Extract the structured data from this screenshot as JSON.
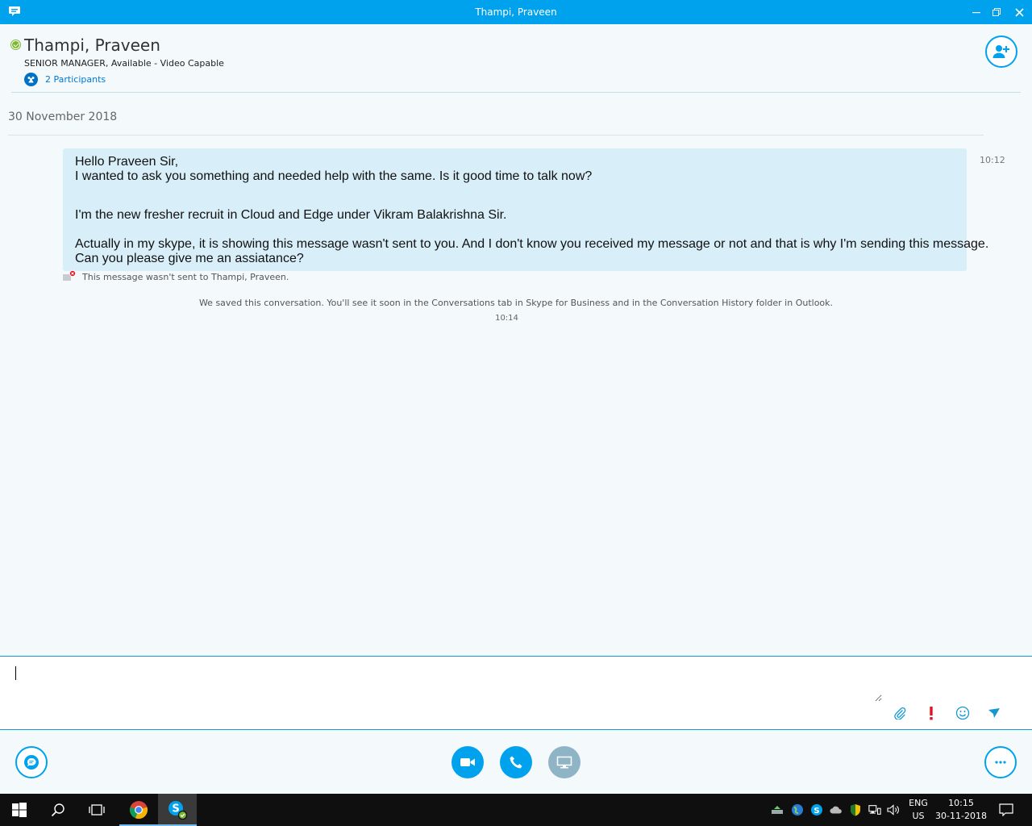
{
  "window": {
    "title": "Thampi, Praveen",
    "accent_color": "#00a2ed",
    "buttons": {
      "minimize": "minimize-icon",
      "restore": "restore-icon",
      "close": "close-icon"
    }
  },
  "contact": {
    "name": "Thampi, Praveen",
    "subtitle": "SENIOR MANAGER,  Available - Video Capable",
    "presence_color": "#7cb82f",
    "participants_label": "2 Participants"
  },
  "conversation": {
    "date": "30 November 2018",
    "message": {
      "lines_block1": [
        "Hello Praveen Sir,",
        "I wanted to ask you something and needed help with the same. Is it good time to talk now?"
      ],
      "line_block2": "I'm the new fresher recruit in Cloud and Edge under Vikram Balakrishna Sir.",
      "lines_block3": [
        "Actually in my skype, it is showing this message wasn't sent to you. And I don't know you received my message or not and that is why I'm sending this message.",
        "Can you please give me an assiatance?"
      ],
      "time": "10:12",
      "bubble_color": "#d8eef8"
    },
    "error_text": "This message wasn't sent to Thampi, Praveen.",
    "saved_note": "We saved this conversation. You'll see it soon in the Conversations tab in Skype for Business and in the Conversation History folder in Outlook.",
    "saved_time": "10:14"
  },
  "compose": {
    "value": "",
    "tools": [
      "attach-icon",
      "high-importance-icon",
      "emoticon-icon",
      "send-icon"
    ]
  },
  "actions": {
    "left": "im-icon",
    "center": [
      "video-icon",
      "phone-icon",
      "present-screen-icon"
    ],
    "right": "more-options-icon"
  },
  "taskbar": {
    "apps": [
      "windows-start-icon",
      "search-icon",
      "task-view-icon",
      "chrome-icon",
      "skype-for-business-icon"
    ],
    "tray": [
      "network-adapter-icon",
      "globe-icon",
      "skype-tray-icon",
      "onedrive-icon",
      "shield-icon",
      "network-icon",
      "volume-icon"
    ],
    "language": "ENG",
    "region": "US",
    "time": "10:15",
    "date": "30-11-2018"
  }
}
